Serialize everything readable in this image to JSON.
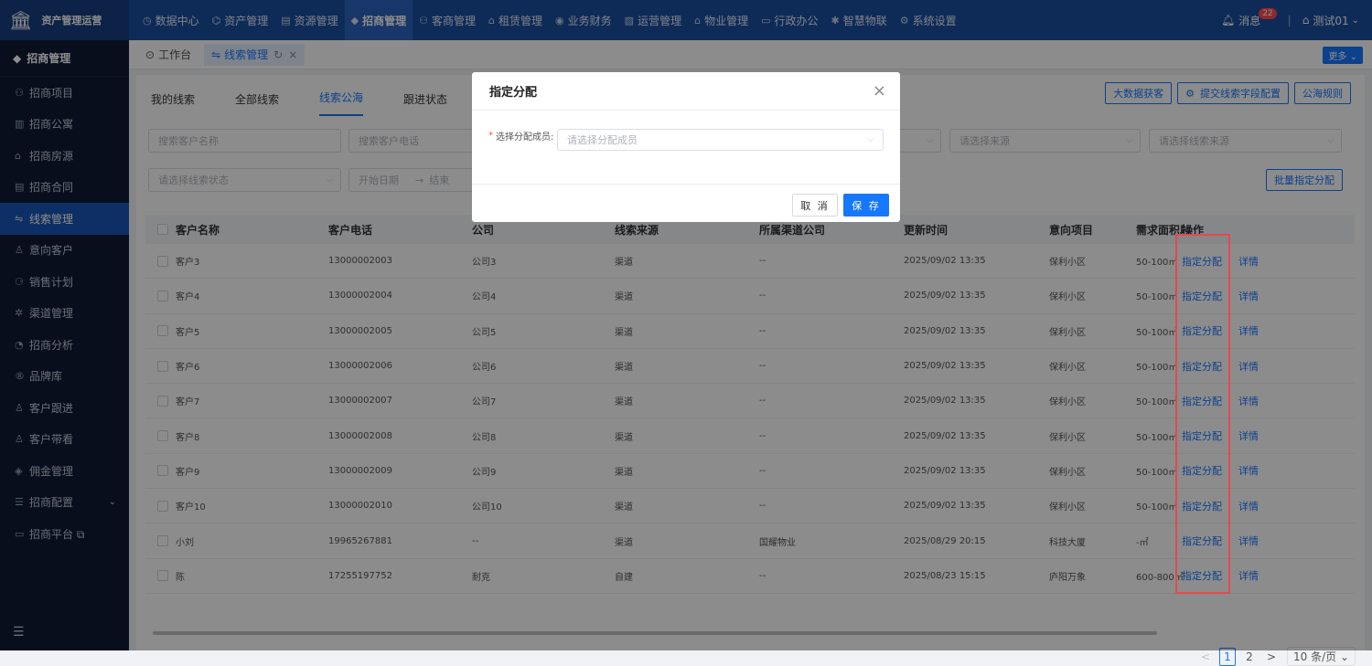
{
  "app": {
    "logo_icon": "bank-icon",
    "title": "资产管理运营"
  },
  "topnav": [
    {
      "icon": "◷",
      "label": "数据中心"
    },
    {
      "icon": "⌬",
      "label": "资产管理"
    },
    {
      "icon": "▤",
      "label": "资源管理"
    },
    {
      "icon": "◆",
      "label": "招商管理",
      "active": true
    },
    {
      "icon": "⚇",
      "label": "客商管理"
    },
    {
      "icon": "⌂",
      "label": "租赁管理"
    },
    {
      "icon": "◉",
      "label": "业务财务"
    },
    {
      "icon": "▧",
      "label": "运营管理"
    },
    {
      "icon": "⌂",
      "label": "物业管理"
    },
    {
      "icon": "▭",
      "label": "行政办公"
    },
    {
      "icon": "✱",
      "label": "智慧物联"
    },
    {
      "icon": "⚙",
      "label": "系统设置"
    }
  ],
  "topright": {
    "message_label": "消息",
    "message_count": "22",
    "user_label": "测试01"
  },
  "sidebar": {
    "title": "招商管理",
    "items": [
      {
        "icon": "⚇",
        "label": "招商项目"
      },
      {
        "icon": "▥",
        "label": "招商公寓"
      },
      {
        "icon": "⌂",
        "label": "招商房源"
      },
      {
        "icon": "▤",
        "label": "招商合同"
      },
      {
        "icon": "⇋",
        "label": "线索管理",
        "active": true
      },
      {
        "icon": "♙",
        "label": "意向客户"
      },
      {
        "icon": "⚆",
        "label": "销售计划"
      },
      {
        "icon": "✲",
        "label": "渠道管理"
      },
      {
        "icon": "◔",
        "label": "招商分析"
      },
      {
        "icon": "®",
        "label": "品牌库"
      },
      {
        "icon": "♙",
        "label": "客户跟进"
      },
      {
        "icon": "♙",
        "label": "客户带看"
      },
      {
        "icon": "◈",
        "label": "佣金管理"
      },
      {
        "icon": "☰",
        "label": "招商配置",
        "chevron": "⌄"
      },
      {
        "icon": "▭",
        "label": "招商平台 ⧉"
      }
    ]
  },
  "pagetabs": [
    {
      "icon": "⊙",
      "label": "工作台"
    },
    {
      "icon": "⇋",
      "label": "线索管理",
      "active": true
    }
  ],
  "more_label": "更多 ⌄",
  "subtabs": [
    "我的线索",
    "全部线索",
    "线索公海",
    "跟进状态"
  ],
  "toolbar": {
    "bigdata": "大数据获客",
    "submit_config": "提交线索字段配置",
    "rules": "公海规则",
    "batch_assign": "批量指定分配"
  },
  "filters": {
    "customer_name": "搜索客户名称",
    "customer_phone": "搜索客户电话",
    "source": "请选择来源",
    "clue_source": "请选择线索来源",
    "clue_status": "请选择线索状态",
    "start_date": "开始日期",
    "end_date_partial": "结束",
    "arrow": "→"
  },
  "table": {
    "columns": [
      "客户名称",
      "客户电话",
      "公司",
      "线索来源",
      "所属渠道公司",
      "更新时间",
      "意向项目",
      "需求面积段",
      "操作"
    ],
    "rows": [
      [
        "客户3",
        "13000002003",
        "公司3",
        "渠道",
        "--",
        "2025/09/02 13:35",
        "保利小区",
        "50-100㎡"
      ],
      [
        "客户4",
        "13000002004",
        "公司4",
        "渠道",
        "--",
        "2025/09/02 13:35",
        "保利小区",
        "50-100㎡"
      ],
      [
        "客户5",
        "13000002005",
        "公司5",
        "渠道",
        "--",
        "2025/09/02 13:35",
        "保利小区",
        "50-100㎡"
      ],
      [
        "客户6",
        "13000002006",
        "公司6",
        "渠道",
        "--",
        "2025/09/02 13:35",
        "保利小区",
        "50-100㎡"
      ],
      [
        "客户7",
        "13000002007",
        "公司7",
        "渠道",
        "--",
        "2025/09/02 13:35",
        "保利小区",
        "50-100㎡"
      ],
      [
        "客户8",
        "13000002008",
        "公司8",
        "渠道",
        "--",
        "2025/09/02 13:35",
        "保利小区",
        "50-100㎡"
      ],
      [
        "客户9",
        "13000002009",
        "公司9",
        "渠道",
        "--",
        "2025/09/02 13:35",
        "保利小区",
        "50-100㎡"
      ],
      [
        "客户10",
        "13000002010",
        "公司10",
        "渠道",
        "--",
        "2025/09/02 13:35",
        "保利小区",
        "50-100㎡"
      ],
      [
        "小刘",
        "19965267881",
        "--",
        "渠道",
        "国耀物业",
        "2025/08/29 20:15",
        "科技大厦",
        "-㎡"
      ],
      [
        "陈",
        "17255197752",
        "耐克",
        "自建",
        "--",
        "2025/08/23 15:15",
        "庐阳万象",
        "600-800㎡"
      ]
    ],
    "action_assign": "指定分配",
    "action_detail": "详情"
  },
  "pagination": {
    "prev": "<",
    "pages": [
      "1",
      "2"
    ],
    "next": ">",
    "size": "10 条/页 ⌄"
  },
  "modal": {
    "title": "指定分配",
    "required_mark": "*",
    "field_label": "选择分配成员:",
    "field_placeholder": "请选择分配成员",
    "cancel": "取 消",
    "save": "保 存"
  },
  "colors": {
    "primary": "#1677ff",
    "topbar": "#1a4fa0",
    "sidebar": "#0f1b34",
    "highlight": "#e5484d"
  }
}
